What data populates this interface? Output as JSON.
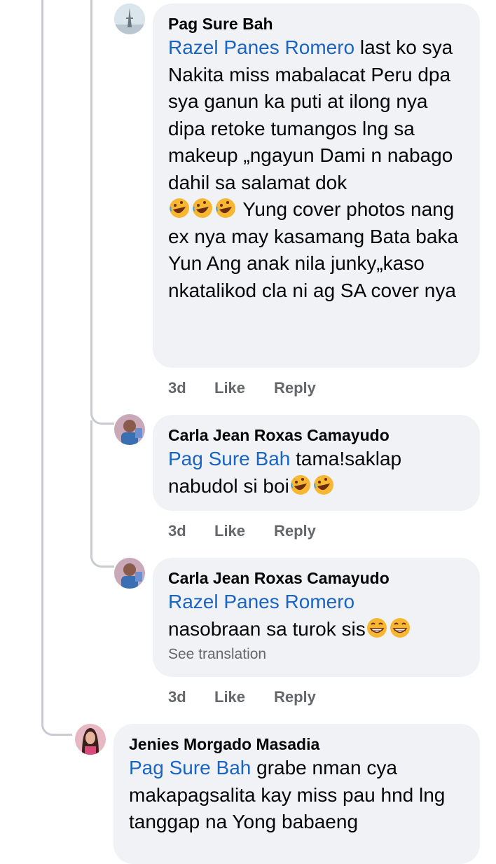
{
  "comments": [
    {
      "author": "Pag Sure Bah",
      "mention": "Razel Panes Romero",
      "text_before_emoji": " last ko sya Nakita miss mabalacat Peru dpa sya ganun ka puti at ilong nya dipa retoke tumangos lng sa makeup „ngayun Dami n nabago  dahil sa salamat  dok",
      "text_after_emoji": " Yung cover photos nang ex nya may kasamang Bata baka Yun Ang anak nila junky„kaso nkatalikod cla ni ag SA cover nya",
      "emojis": [
        "rofl-emoji",
        "rofl-emoji",
        "rofl-emoji"
      ],
      "time": "3d",
      "like": "Like",
      "reply": "Reply"
    },
    {
      "author": "Carla Jean Roxas Camayudo",
      "mention": "Pag Sure Bah",
      "text": " tama!saklap nabudol si boi",
      "emojis": [
        "rofl-emoji",
        "rofl-emoji"
      ],
      "time": "3d",
      "like": "Like",
      "reply": "Reply"
    },
    {
      "author": "Carla Jean Roxas Camayudo",
      "mention": "Razel Panes Romero",
      "text": "nasobraan sa turok sis",
      "emojis": [
        "grin-emoji",
        "grin-emoji"
      ],
      "see_translation": "See translation",
      "time": "3d",
      "like": "Like",
      "reply": "Reply"
    },
    {
      "author": "Jenies Morgado Masadia",
      "mention": "Pag Sure Bah",
      "text": " grabe nman cya makapagsalita kay miss pau hnd lng tanggap na Yong babaeng"
    }
  ],
  "colors": {
    "bubble": "#f0f2f5",
    "mention": "#1a64c4",
    "meta": "#65676b",
    "thread_line": "#c8cbd0"
  }
}
